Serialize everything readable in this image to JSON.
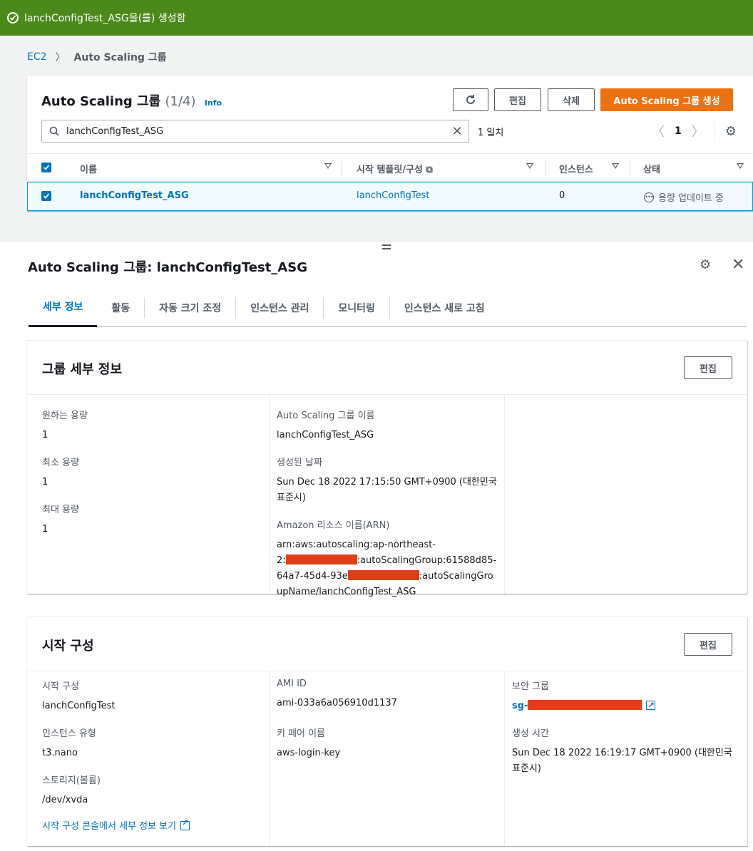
{
  "flash": {
    "message": "lanchConfigTest_ASG을(를) 생성함"
  },
  "breadcrumb": {
    "root": "EC2",
    "current": "Auto Scaling 그룹"
  },
  "table": {
    "title": "Auto Scaling 그룹",
    "count": "(1/4)",
    "info": "Info",
    "buttons": {
      "edit": "편집",
      "delete": "삭제",
      "create": "Auto Scaling 그룹 생성"
    },
    "search": {
      "value": "lanchConfigTest_ASG"
    },
    "matches": "1 일치",
    "page": "1",
    "columns": {
      "name": "이름",
      "template": "시작 템플릿/구성",
      "instances": "인스턴스",
      "status": "상태"
    },
    "rows": [
      {
        "name": "lanchConfigTest_ASG",
        "template": "lanchConfigTest",
        "instances": "0",
        "status": "용량 업데이트 중"
      }
    ]
  },
  "detail": {
    "title": "Auto Scaling 그룹: lanchConfigTest_ASG",
    "tabs": [
      "세부 정보",
      "활동",
      "자동 크기 조정",
      "인스턴스 관리",
      "모니터링",
      "인스턴스 새로 고침"
    ],
    "group": {
      "title": "그룹 세부 정보",
      "edit": "편집",
      "desired_label": "원하는 용량",
      "desired": "1",
      "min_label": "최소 용량",
      "min": "1",
      "max_label": "최대 용량",
      "max": "1",
      "name_label": "Auto Scaling 그룹 이름",
      "name": "lanchConfigTest_ASG",
      "created_label": "생성된 날짜",
      "created_1": "Sun Dec 18 2022 17:15:50 GMT+0900 (대한민국",
      "created_2": "표준시)",
      "arn_label": "Amazon 리소스 이름(ARN)",
      "arn_1": "arn:aws:autoscaling:ap-northeast-",
      "arn_2a": "2:",
      "arn_2b": ":autoScalingGroup:61588d85-",
      "arn_3a": "64a7-45d4-93e",
      "arn_3b": ":autoScalingGro",
      "arn_4": "upName/lanchConfigTest_ASG"
    },
    "launch": {
      "title": "시작 구성",
      "edit": "편집",
      "config_label": "시작 구성",
      "config": "lanchConfigTest",
      "type_label": "인스턴스 유형",
      "type": "t3.nano",
      "storage_label": "스토리지(볼륨)",
      "storage": "/dev/xvda",
      "console_link": "시작 구성 콘솔에서 세부 정보 보기",
      "ami_label": "AMI ID",
      "ami": "ami-033a6a056910d1137",
      "key_label": "키 페어 이름",
      "key": "aws-login-key",
      "sg_label": "보안 그룹",
      "sg_prefix": "sg-",
      "time_label": "생성 시간",
      "time_1": "Sun Dec 18 2022 16:19:17 GMT+0900 (대한민국",
      "time_2": "표준시)"
    }
  }
}
